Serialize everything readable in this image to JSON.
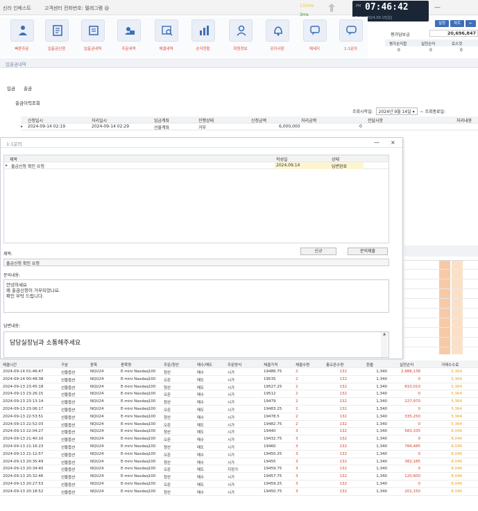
{
  "header": {
    "brand": "신라 인베스트",
    "phone": "고객센터 전화번호: 텔레그램 @",
    "latency1": "132ms",
    "latency2": "3ms",
    "clock_ampm": "PM",
    "clock_time": "07:46:42",
    "clock_date": "Today 2024.09.15[일]",
    "minimize": "—"
  },
  "toolbar": [
    {
      "label": "빠른주문",
      "icon": "order-icon"
    },
    {
      "label": "입출금신청",
      "icon": "deposit-request-icon"
    },
    {
      "label": "입출금내역",
      "icon": "deposit-history-icon"
    },
    {
      "label": "주문내역",
      "icon": "order-history-icon"
    },
    {
      "label": "체결내역",
      "icon": "execution-history-icon"
    },
    {
      "label": "손익현황",
      "icon": "pnl-chart-icon"
    },
    {
      "label": "회원정보",
      "icon": "member-icon"
    },
    {
      "label": "공지사항",
      "icon": "bell-icon"
    },
    {
      "label": "메세지",
      "icon": "message-icon"
    },
    {
      "label": "1:1문의",
      "icon": "chat-icon"
    }
  ],
  "account": {
    "buttons": [
      "설정",
      "차트",
      "←"
    ],
    "eval_label": "평가담보금",
    "eval_value": "20,696,847",
    "headers": [
      "평가손익합",
      "실현손익",
      "로스컷"
    ],
    "values": [
      "0",
      "0",
      "0"
    ]
  },
  "deposit": {
    "window_title": "입출금내역",
    "tabs": [
      "입금",
      "출금"
    ],
    "section_title": "출금이력조회",
    "filter_start_label": "조회시작일:",
    "filter_start_value": "2024년  9월 14일",
    "filter_tilde": "~",
    "filter_end_label": "조회종료일:",
    "columns": [
      "신청일시",
      "처리일시",
      "입금계좌",
      "진행상태",
      "신청금액",
      "처리금액",
      "전달사항",
      "처리내용"
    ],
    "rows": [
      [
        "2024-09-14 02:19",
        "2024-09-14 02:29",
        "선물계좌",
        "거부",
        "6,000,000",
        "0",
        "",
        ""
      ]
    ]
  },
  "inquiry": {
    "window_title": "1:1문의",
    "minimize": "—",
    "close": "×",
    "columns": [
      "제목",
      "작성일",
      "상태"
    ],
    "rows": [
      [
        "출금신청 확인 요청",
        "2024.09.14",
        "답변완료"
      ]
    ],
    "subject_label": "제목:",
    "new_button": "신규",
    "register_button": "문의제출",
    "subject_value": "출금신청 확인 요청",
    "content_label": "문의내용:",
    "content_lines": [
      "안녕하세요",
      "왜 출금신청이 거부되었나요.",
      "확인 부탁 드립니다."
    ],
    "answer_label": "답변내용:",
    "answer_value": "담당실장님과 소통해주세요"
  },
  "trades": {
    "columns": [
      "체결시간",
      "구분",
      "종목",
      "종목명",
      "주문/청산",
      "매수/매도",
      "주문방식",
      "체결가격",
      "체결수량",
      "총오픈수량",
      "환율",
      "실현손익",
      "거래수수료"
    ],
    "rows": [
      [
        "2024-09-14  01:46:47",
        "선물옵션",
        "NQU24",
        "E-mini Nasdaq100",
        "청산",
        "매수",
        "시가",
        "19486.75",
        "2",
        "132",
        "1,340",
        "2,986,138",
        "5,364"
      ],
      [
        "2024-09-14  00:48:38",
        "선물옵션",
        "NQU24",
        "E-mini Nasdaq100",
        "오픈",
        "매도",
        "시가",
        "19535",
        "2",
        "132",
        "1,340",
        "0",
        "5,364"
      ],
      [
        "2024-09-13  23:45:18",
        "선물옵션",
        "NQU24",
        "E-mini Nasdaq100",
        "청산",
        "매도",
        "시가",
        "19527.25",
        "2",
        "132",
        "1,340",
        "810,010",
        "5,364"
      ],
      [
        "2024-09-13  23:26:15",
        "선물옵션",
        "NQU24",
        "E-mini Nasdaq100",
        "오픈",
        "매수",
        "시가",
        "19512",
        "2",
        "132",
        "1,340",
        "0",
        "5,364"
      ],
      [
        "2024-09-13  23:13:14",
        "선물옵션",
        "NQU24",
        "E-mini Nasdaq100",
        "청산",
        "매수",
        "시가",
        "19479",
        "2",
        "132",
        "1,340",
        "227,970",
        "5,364"
      ],
      [
        "2024-09-13  23:06:17",
        "선물옵션",
        "NQU24",
        "E-mini Nasdaq100",
        "오픈",
        "매도",
        "시가",
        "19483.25",
        "2",
        "132",
        "1,340",
        "0",
        "5,364"
      ],
      [
        "2024-09-13  22:53:51",
        "선물옵션",
        "NQU24",
        "E-mini Nasdaq100",
        "청산",
        "매수",
        "시가",
        "19478.5",
        "2",
        "132",
        "1,340",
        "335,250",
        "5,364"
      ],
      [
        "2024-09-13  22:52:03",
        "선물옵션",
        "NQU24",
        "E-mini Nasdaq100",
        "오픈",
        "매도",
        "시가",
        "19482.75",
        "2",
        "132",
        "1,340",
        "0",
        "5,364"
      ],
      [
        "2024-09-13  22:04:27",
        "선물옵션",
        "NQU24",
        "E-mini Nasdaq100",
        "청산",
        "매도",
        "시가",
        "19440",
        "3",
        "132",
        "1,340",
        "583,335",
        "8,046"
      ],
      [
        "2024-09-13  21:40:10",
        "선물옵션",
        "NQU24",
        "E-mini Nasdaq100",
        "오픈",
        "매수",
        "시가",
        "19432.75",
        "3",
        "132",
        "1,340",
        "0",
        "8,046"
      ],
      [
        "2024-09-13  21:16:23",
        "선물옵션",
        "NQU24",
        "E-mini Nasdaq100",
        "청산",
        "매도",
        "시가",
        "19460",
        "3",
        "132",
        "1,340",
        "784,485",
        "8,046"
      ],
      [
        "2024-09-13  21:12:57",
        "선물옵션",
        "NQU24",
        "E-mini Nasdaq100",
        "오픈",
        "매수",
        "시가",
        "19450.25",
        "3",
        "132",
        "1,340",
        "0",
        "8,046"
      ],
      [
        "2024-09-13  20:35:49",
        "선물옵션",
        "NQU24",
        "E-mini Nasdaq100",
        "청산",
        "매수",
        "시가",
        "19455",
        "3",
        "132",
        "1,340",
        "382,185",
        "8,046"
      ],
      [
        "2024-09-13  20:34:40",
        "선물옵션",
        "NQU24",
        "E-mini Nasdaq100",
        "오픈",
        "매도",
        "지정가",
        "19459.75",
        "3",
        "132",
        "1,340",
        "0",
        "8,046"
      ],
      [
        "2024-09-13  20:32:46",
        "선물옵션",
        "NQU24",
        "E-mini Nasdaq100",
        "청산",
        "매수",
        "시가",
        "19457.75",
        "3",
        "132",
        "1,340",
        "120,600",
        "8,046"
      ],
      [
        "2024-09-13  20:27:53",
        "선물옵션",
        "NQU24",
        "E-mini Nasdaq100",
        "오픈",
        "매도",
        "시가",
        "19459.25",
        "3",
        "132",
        "1,340",
        "0",
        "8,046"
      ],
      [
        "2024-09-13  20:18:52",
        "선물옵션",
        "NQU24",
        "E-mini Nasdaq100",
        "청산",
        "매수",
        "시가",
        "19450.75",
        "3",
        "132",
        "1,340",
        "201,150",
        "8,046"
      ]
    ]
  },
  "colors": {
    "accent_red": "#d23b2b",
    "fee_orange": "#e5a020",
    "highlight_peach": "#f7c9a6",
    "button_blue": "#3f6fb8"
  }
}
